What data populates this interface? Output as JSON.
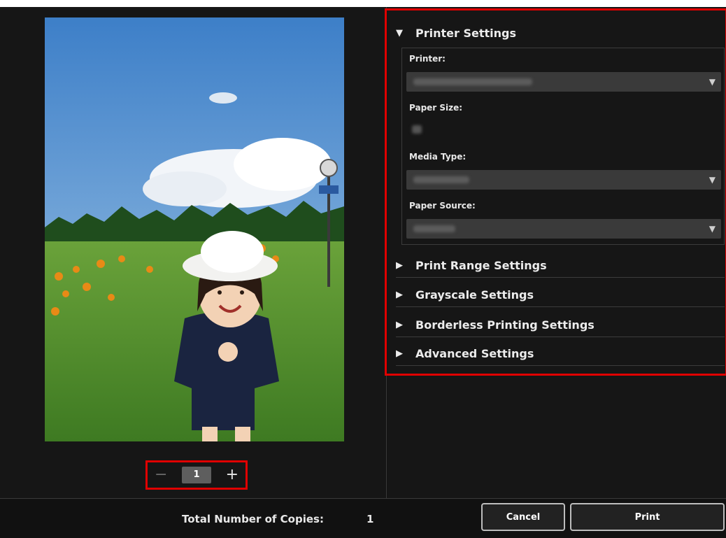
{
  "preview": {
    "copies": "1",
    "minus_symbol": "−",
    "plus_symbol": "+"
  },
  "settings": {
    "printer_section": "Printer Settings",
    "printer_label": "Printer:",
    "paper_size_label": "Paper Size:",
    "media_type_label": "Media Type:",
    "paper_source_label": "Paper Source:",
    "print_range_section": "Print Range Settings",
    "grayscale_section": "Grayscale Settings",
    "borderless_section": "Borderless Printing Settings",
    "advanced_section": "Advanced Settings",
    "expanded_glyph": "▼",
    "collapsed_glyph": "▶",
    "dropdown_glyph": "▼"
  },
  "footer": {
    "total_copies_label": "Total Number of Copies:",
    "total_copies_value": "1",
    "cancel_label": "Cancel",
    "print_label": "Print"
  },
  "colors": {
    "highlight": "#e00000",
    "panel_bg": "#161616",
    "dropdown_bg": "#3a3a3a"
  }
}
